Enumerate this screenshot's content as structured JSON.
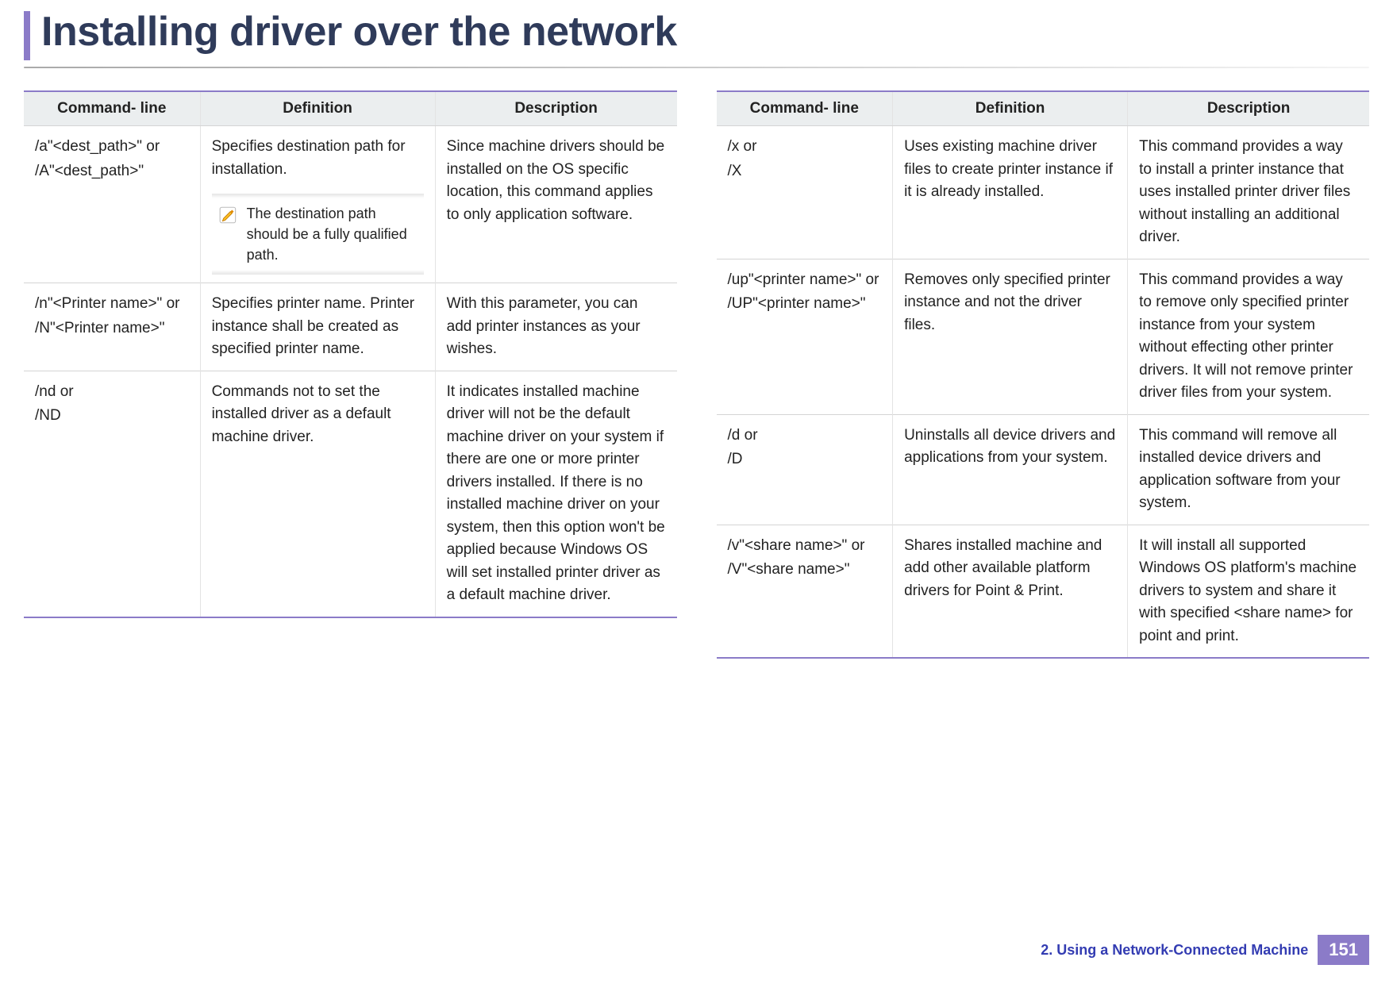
{
  "title": "Installing driver over the network",
  "table_headers": {
    "command": "Command- line",
    "definition": "Definition",
    "description": "Description"
  },
  "note_icon_name": "pencil-note-icon",
  "left_rows": [
    {
      "command_lines": [
        "/a\"<dest_path>\" or",
        "/A\"<dest_path>\""
      ],
      "definition": "Specifies destination path for installation.",
      "note": "The destination path should be a fully qualified path.",
      "description": "Since machine drivers should be installed on the OS specific location, this command applies to only application software."
    },
    {
      "command_lines": [
        "/n\"<Printer name>\" or",
        "/N\"<Printer name>\""
      ],
      "definition": "Specifies printer name. Printer instance shall be created as specified printer name.",
      "description": "With this parameter, you can add printer instances as your wishes."
    },
    {
      "command_lines": [
        "/nd or",
        "/ND"
      ],
      "definition": "Commands not to set the installed driver as a default machine driver.",
      "description": "It indicates installed machine driver will not be the default machine driver on your system if there are one or more printer drivers installed. If there is no installed machine driver on your system, then this option won't be applied because Windows OS will set installed printer driver as a default machine driver."
    }
  ],
  "right_rows": [
    {
      "command_lines": [
        "/x or",
        "/X"
      ],
      "definition": "Uses existing machine driver files to create printer instance if it is already installed.",
      "description": "This command provides a way to install a printer instance that uses installed printer driver files without installing an additional driver."
    },
    {
      "command_lines": [
        "/up\"<printer name>\" or",
        "/UP\"<printer name>\""
      ],
      "definition": "Removes only specified printer instance and not the driver files.",
      "description": "This command provides a way to remove only specified printer instance from your system without effecting other printer drivers. It will not remove printer driver files from your system."
    },
    {
      "command_lines": [
        "/d or",
        "/D"
      ],
      "definition": "Uninstalls all device drivers and applications from your system.",
      "description": "This command will remove all installed device drivers and application software from your system."
    },
    {
      "command_lines": [
        "/v\"<share name>\" or",
        "/V\"<share name>\""
      ],
      "definition": "Shares installed machine and add other available platform drivers for Point & Print.",
      "description": "It will install all supported Windows OS platform's machine drivers to system and share it with specified <share name> for point and print."
    }
  ],
  "footer": {
    "section": "2.  Using a Network-Connected Machine",
    "page": "151"
  }
}
